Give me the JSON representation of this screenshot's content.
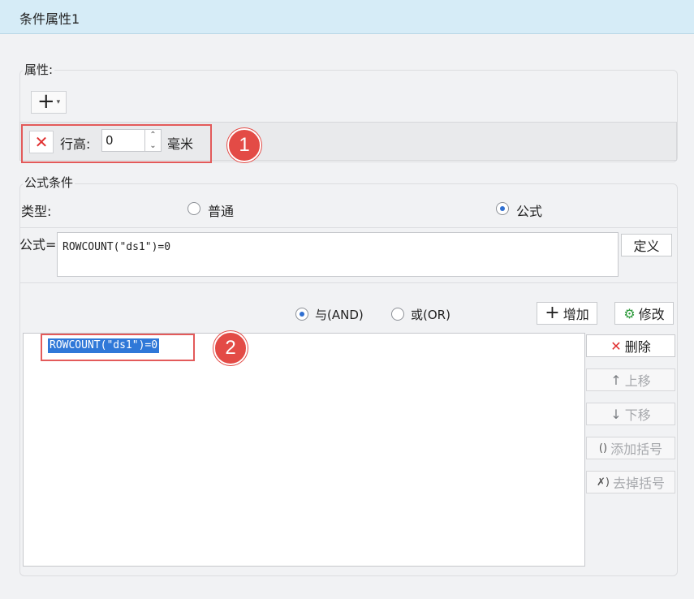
{
  "window": {
    "title": "条件属性1"
  },
  "properties": {
    "section_label": "属性:",
    "add_button": {
      "icon": "plus-icon",
      "caret": "▾"
    },
    "row": {
      "delete_icon": "close-icon",
      "label": "行高:",
      "value": "0",
      "unit": "毫米"
    }
  },
  "formula_condition": {
    "section_label": "公式条件",
    "type_label": "类型:",
    "type_options": [
      {
        "label": "普通",
        "checked": false
      },
      {
        "label": "公式",
        "checked": true
      }
    ],
    "formula_label": "公式=",
    "formula_value": "ROWCOUNT(\"ds1\")=0",
    "define_button": "定义"
  },
  "logic": {
    "options": [
      {
        "label": "与(AND)",
        "checked": true
      },
      {
        "label": "或(OR)",
        "checked": false
      }
    ],
    "add_button": "增加",
    "modify_button": "修改"
  },
  "conditions_list": {
    "items": [
      "ROWCOUNT(\"ds1\")=0"
    ]
  },
  "side_buttons": {
    "delete": "删除",
    "move_up": "上移",
    "move_down": "下移",
    "add_parens": "添加括号",
    "remove_parens": "去掉括号"
  },
  "annotations": {
    "badge1": "1",
    "badge2": "2"
  },
  "colors": {
    "accent": "#2f78d8",
    "highlight_box": "#e35a5a",
    "badge": "#e34b46",
    "titlebar": "#d6ecf7"
  }
}
